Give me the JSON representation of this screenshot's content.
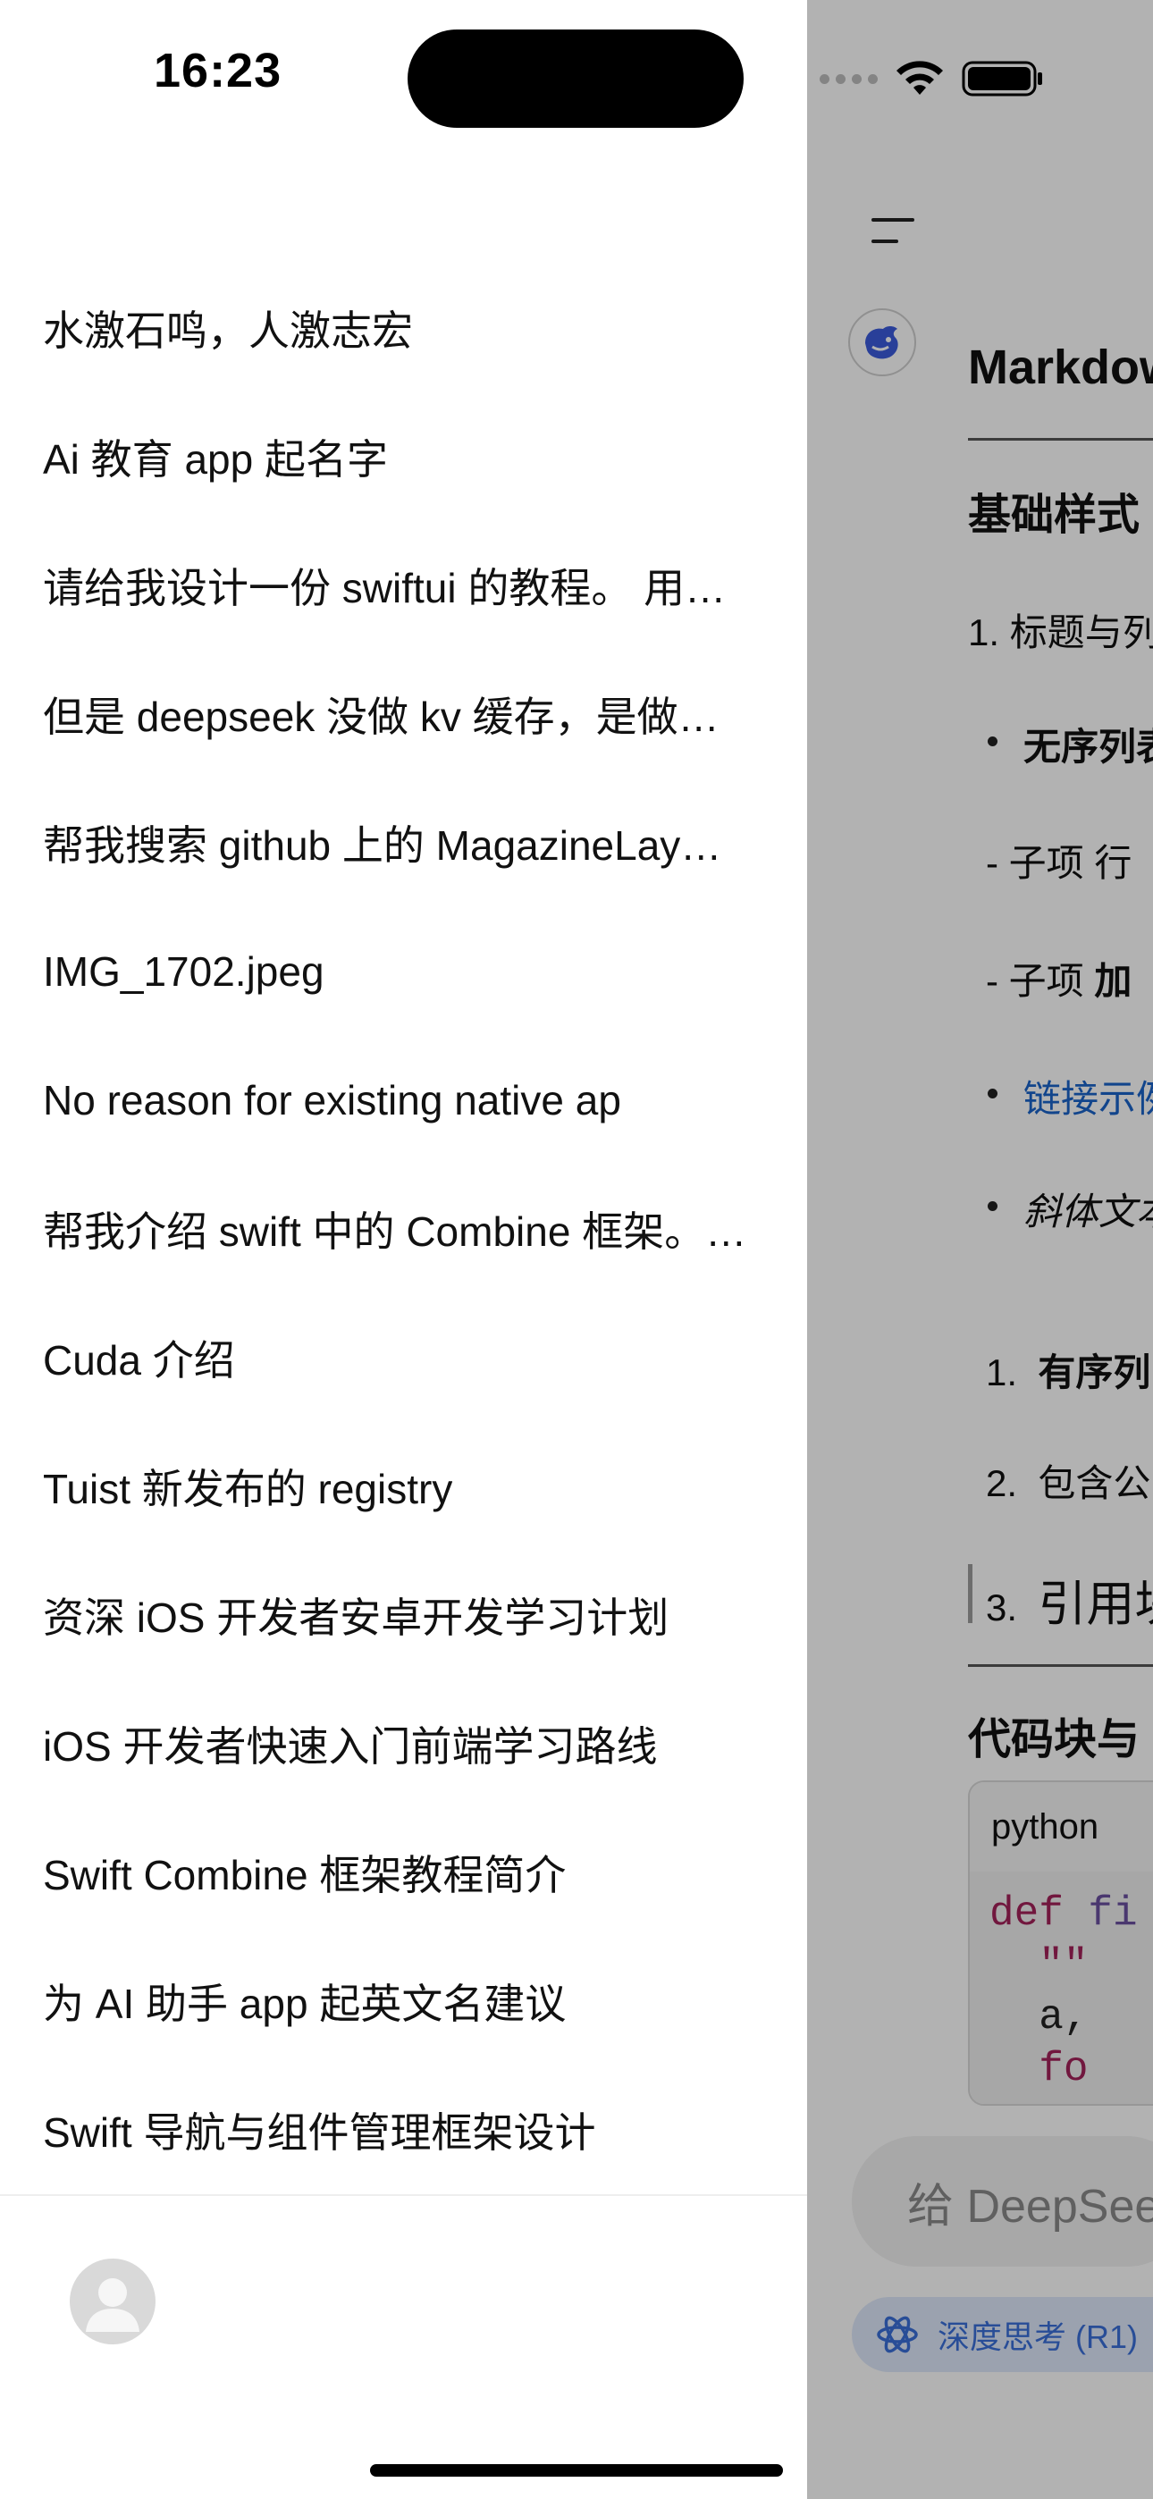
{
  "status_bar": {
    "time": "16:23"
  },
  "drawer": {
    "history": [
      "水激石鸣，人激志宏",
      "Ai 教育 app 起名字",
      "请给我设计一份 swiftui 的教程。 用…",
      "但是 deepseek 没做 kv 缓存，是做…",
      "帮我搜索 github 上的 MagazineLay…",
      "IMG_1702.jpeg",
      "No reason for existing native ap",
      "帮我介绍 swift 中的 Combine 框架。…",
      "Cuda 介绍",
      "Tuist 新发布的 registry",
      "资深 iOS 开发者安卓开发学习计划",
      "iOS 开发者快速入门前端学习路线",
      "Swift Combine 框架教程简介",
      "为 AI 助手 app 起英文名建议",
      "Swift 导航与组件管理框架设计"
    ]
  },
  "chat": {
    "title": "Markdow",
    "section1": "基础样式",
    "item_heading": "1. 标题与列",
    "bullet1": "无序列表",
    "sub1": "- 子项 行",
    "sub2_prefix": "- 子项 ",
    "sub2_bold": "加",
    "bullet_link": "链接示例",
    "bullet_italic": "斜体文本",
    "ol1_num": "1.",
    "ol1_text": "有序列",
    "ol2_num": "2.",
    "ol2_text": "包含公",
    "ol3_num": "3.",
    "ol3_text": "引用块",
    "section2": "代码块与",
    "code_lang": "python",
    "code_line1_kw": "def",
    "code_line1_fn": " fi",
    "code_line2": "  \"\"",
    "code_line3": "  a,",
    "code_line4_kw": "  fo",
    "input_placeholder": "给 DeepSeek",
    "deep_think": "深度思考 (R1)"
  },
  "colors": {
    "link": "#1a63c9",
    "deep_think_bg": "#dfe9fb",
    "deep_think_fg": "#3a6fd8",
    "code_keyword": "#a3215a",
    "code_function": "#6a4fa0"
  }
}
